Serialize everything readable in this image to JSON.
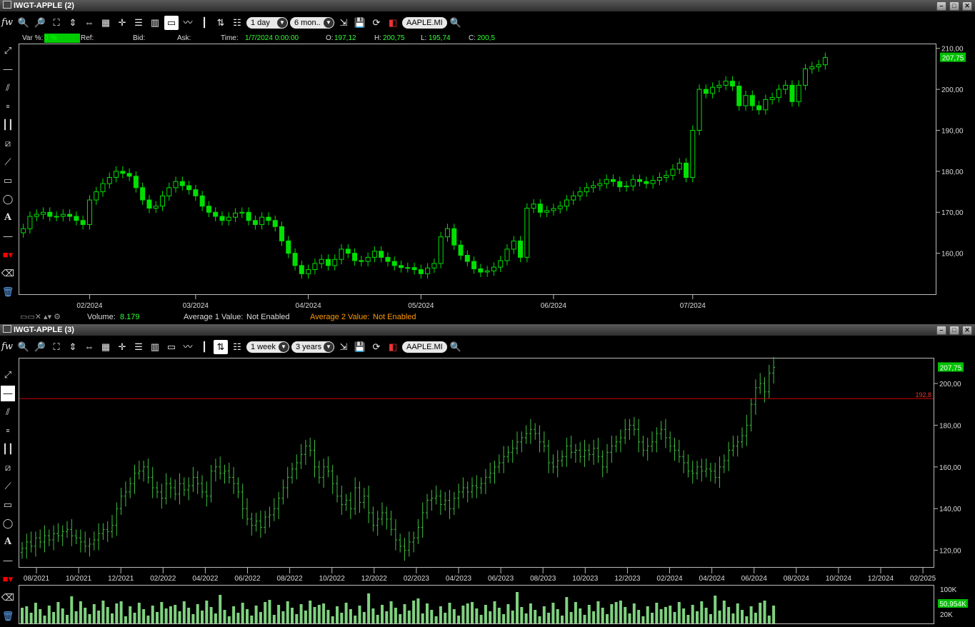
{
  "window1": {
    "title": "IWGT-APPLE (2)",
    "interval": "1 day",
    "range": "6 mon..",
    "symbol": "AAPLE.MI",
    "info": {
      "var_label": "Var %:",
      "var_value": "0 %",
      "ref_label": "Ref:",
      "bid_label": "Bid:",
      "ask_label": "Ask:",
      "time_label": "Time:",
      "time_value": "1/7/2024 0:00:00",
      "o_label": "O:",
      "o_value": "197,12",
      "h_label": "H:",
      "h_value": "200,75",
      "l_label": "L:",
      "l_value": "195,74",
      "c_label": "C:",
      "c_value": "200,5"
    },
    "bottom": {
      "volume_label": "Volume:",
      "volume_value": "8.179",
      "avg1_label": "Average 1 Value:",
      "avg1_value": "Not Enabled",
      "avg2_label": "Average 2 Value:",
      "avg2_value": "Not Enabled"
    }
  },
  "window2": {
    "title": "IWGT-APPLE (3)",
    "interval": "1 week",
    "range": "3 years",
    "symbol": "AAPLE.MI"
  },
  "colors": {
    "up": "#00e000",
    "down": "#00e000",
    "bar": "#3fbf3f",
    "volume": "#7fd27f",
    "hline": "#d00000",
    "badge": "#00c000"
  },
  "chart_data": [
    {
      "type": "candlestick",
      "x_ticks": [
        "02/2024",
        "03/2024",
        "04/2024",
        "05/2024",
        "06/2024",
        "07/2024"
      ],
      "y_ticks": [
        "160,00",
        "170,00",
        "180,00",
        "190,00",
        "200,00",
        "210,00"
      ],
      "ylim": [
        150,
        211
      ],
      "last_price_label": "207,75",
      "last_price": 207.75,
      "closes": [
        166,
        169,
        169.5,
        170,
        169,
        169,
        169.5,
        169,
        168,
        167,
        173,
        175,
        177,
        178.5,
        180,
        179.5,
        178.8,
        176,
        173,
        171,
        171.5,
        174,
        176,
        177.5,
        176.5,
        175.5,
        174,
        171.5,
        170,
        169,
        168,
        168.8,
        169.8,
        170,
        168,
        167,
        168.8,
        168,
        166.5,
        163,
        160,
        157,
        155,
        156,
        157.5,
        158.5,
        157,
        158.5,
        161,
        160,
        158.2,
        158,
        159,
        160.5,
        159,
        158,
        157,
        156.5,
        156.5,
        156,
        155,
        156.4,
        157.5,
        164,
        166,
        162,
        159.5,
        158,
        156.2,
        155.4,
        155.7,
        156.6,
        158.2,
        161,
        163,
        159,
        171,
        172,
        170,
        170.4,
        170.9,
        171.5,
        173,
        174,
        175,
        176,
        176.5,
        177,
        178,
        177.5,
        176.2,
        176.4,
        178,
        177.5,
        177,
        177.8,
        178.5,
        179,
        180.5,
        182,
        178.5,
        190,
        200,
        199,
        200.5,
        201,
        202,
        200.8,
        196,
        198.5,
        196,
        195,
        197.5,
        198,
        200,
        201,
        197,
        201,
        205,
        205.5,
        206,
        207.75
      ],
      "x_tick_index": [
        10,
        26,
        43,
        60,
        80,
        101
      ]
    },
    {
      "type": "ohlc",
      "x_ticks": [
        "08/2021",
        "10/2021",
        "12/2021",
        "02/2022",
        "04/2022",
        "06/2022",
        "08/2022",
        "10/2022",
        "12/2022",
        "02/2023",
        "04/2023",
        "06/2023",
        "08/2023",
        "10/2023",
        "12/2023",
        "02/2024",
        "04/2024",
        "06/2024",
        "08/2024",
        "10/2024",
        "12/2024",
        "02/2025"
      ],
      "y_ticks": [
        "120,00",
        "140,00",
        "160,00",
        "180,00",
        "200,00"
      ],
      "ylim": [
        112,
        212
      ],
      "horizontal_line": 192.8,
      "horizontal_line_label": "192,8",
      "last_price_label": "207,75",
      "last_price": 207.75,
      "closes": [
        121,
        124,
        122,
        126,
        124,
        127,
        125,
        128,
        127,
        129,
        130,
        127,
        126,
        124,
        122,
        123,
        125,
        128,
        130,
        129,
        132,
        140,
        146,
        148,
        152,
        157,
        158,
        160,
        155,
        150,
        148,
        145,
        152,
        150,
        147,
        152,
        149,
        151,
        155,
        152,
        148,
        146,
        158,
        160,
        157,
        158,
        155,
        152,
        148,
        140,
        135,
        132,
        134,
        131,
        136,
        137,
        140,
        145,
        150,
        155,
        159,
        162,
        166,
        170,
        168,
        160,
        155,
        160,
        158,
        152,
        146,
        142,
        144,
        140,
        150,
        143,
        146,
        138,
        132,
        135,
        138,
        135,
        130,
        125,
        122,
        120,
        124,
        126,
        131,
        138,
        144,
        145,
        146,
        142,
        144,
        140,
        145,
        148,
        150,
        148,
        151,
        150,
        152,
        155,
        157,
        160,
        162,
        165,
        167,
        169,
        172,
        174,
        176,
        178,
        176,
        172,
        170,
        162,
        160,
        163,
        165,
        170,
        167,
        168,
        165,
        168,
        166,
        169,
        165,
        160,
        167,
        170,
        172,
        174,
        178,
        180,
        178,
        172,
        168,
        170,
        172,
        176,
        178,
        174,
        170,
        168,
        165,
        162,
        158,
        157,
        160,
        158,
        159,
        158,
        155,
        160,
        163,
        168,
        170,
        172,
        175,
        180,
        190,
        198,
        200,
        196,
        205,
        207.75
      ],
      "volume_ticks": [
        "100K",
        "20K"
      ],
      "volume_label": "50,954K"
    }
  ]
}
